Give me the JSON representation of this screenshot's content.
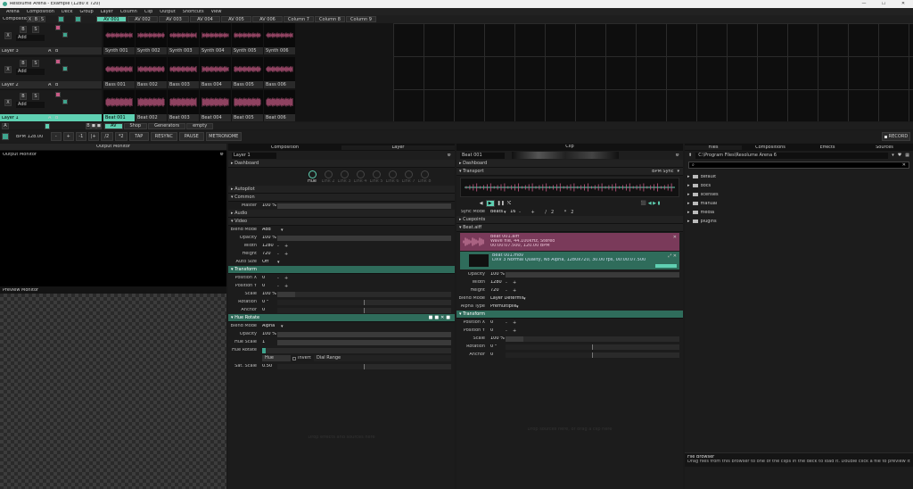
{
  "window": {
    "title": "Resolume Arena - Example (1280 x 720)"
  },
  "menu": [
    "Arena",
    "Composition",
    "Deck",
    "Group",
    "Layer",
    "Column",
    "Clip",
    "Output",
    "Shortcuts",
    "View"
  ],
  "composition": {
    "label": "Composition",
    "x": "X",
    "b": "B",
    "s": "S"
  },
  "columns": [
    "AV 001",
    "AV 002",
    "AV 003",
    "AV 004",
    "AV 005",
    "AV 006",
    "Column 7",
    "Column 8",
    "Column 9"
  ],
  "layers": [
    {
      "name": "Layer 3",
      "blend": "Add",
      "clips": [
        "Synth 001",
        "Synth 002",
        "Synth 003",
        "Synth 004",
        "Synth 005",
        "Synth 006"
      ]
    },
    {
      "name": "Layer 2",
      "blend": "Add",
      "clips": [
        "Bass 001",
        "Bass 002",
        "Bass 003",
        "Bass 004",
        "Bass 005",
        "Bass 006"
      ]
    },
    {
      "name": "Layer 1",
      "blend": "Add",
      "clips": [
        "Beat 001",
        "Beat 002",
        "Beat 003",
        "Beat 004",
        "Beat 005",
        "Beat 006"
      ]
    }
  ],
  "layer_controls": {
    "x": "X",
    "b": "B",
    "s": "S",
    "a": "A",
    "bb": "B"
  },
  "decks": [
    "AV",
    "Shop",
    "Generators",
    "empty"
  ],
  "transport": {
    "bpm_label": "BPM",
    "bpm": "128.00",
    "minus": "-",
    "plus": "+",
    "m1": "-1",
    "p1": "|+",
    "half": "/2",
    "dbl": "*2",
    "tap": "TAP",
    "resync": "RESYNC",
    "pause": "PAUSE",
    "metronome": "METRONOME",
    "record": "RECORD"
  },
  "output_monitor": {
    "title": "Output Monitor",
    "label": "Output Monitor"
  },
  "preview_monitor": {
    "label": "Preview Monitor"
  },
  "tabs_mid": [
    "Composition",
    "Layer"
  ],
  "layer_panel": {
    "name": "Layer 1",
    "dashboard": "Dashboard",
    "dash_knobs": [
      "Hue",
      "Link 2",
      "Link 3",
      "Link 4",
      "Link 5",
      "Link 6",
      "Link 7",
      "Link 8"
    ],
    "autopilot": "Autopilot",
    "common": "Common",
    "master_label": "Master",
    "master_val": "100 %",
    "audio": "Audio",
    "video": "Video",
    "blend_label": "Blend Mode",
    "blend_val": "Add",
    "opacity_label": "Opacity",
    "opacity_val": "100 %",
    "width_label": "Width",
    "width_val": "1280",
    "height_label": "Height",
    "height_val": "720",
    "autosize_label": "Auto Size",
    "autosize_val": "Off",
    "transform": "Transform",
    "posx_label": "Position X",
    "posx_val": "0",
    "posy_label": "Position Y",
    "posy_val": "0",
    "scale_label": "Scale",
    "scale_val": "100 %",
    "rotation_label": "Rotation",
    "rotation_val": "0 °",
    "anchor_label": "Anchor",
    "anchor_val": "0",
    "hue_rotate": "Hue Rotate",
    "hr_blend_label": "Blend Mode",
    "hr_blend_val": "Alpha",
    "hr_opacity_label": "Opacity",
    "hr_opacity_val": "100 %",
    "hue_scale_label": "Hue Scale",
    "hue_scale_val": "1",
    "hue_rot_label": "Hue Rotate",
    "hue_chip": "Hue",
    "invert": "Invert",
    "dial": "Dial Range",
    "sat_label": "Sat. Scale",
    "sat_val": "0.50",
    "drop_hint": "Drop effects and sources here"
  },
  "clip_panel": {
    "tab": "Clip",
    "name": "Beat 001",
    "dashboard": "Dashboard",
    "transport": "Transport",
    "bpm_sync": "BPM Sync",
    "sync_label": "Sync Mode",
    "sync_val": "Beats",
    "beats": "16",
    "cuepoints": "Cuepoints",
    "audio_file": "Beat.aiff",
    "audio_info": "Beat 001.aiff",
    "audio_info2": "Wave file, 44.100kHz, Stereo",
    "audio_info3": "00:00:07.500, 120.00 BPM",
    "video_info": "Beat 001.mov",
    "video_info2": "DXV 3 Normal Quality, No Alpha, 1280x720, 30.00 fps, 00:00:07.500",
    "opacity_label": "Opacity",
    "opacity_val": "100 %",
    "width_label": "Width",
    "width_val": "1280",
    "height_label": "Height",
    "height_val": "720",
    "blend_label": "Blend Mode",
    "blend_val": "Layer Determined",
    "alpha_label": "Alpha Type",
    "alpha_val": "Premultiplied",
    "transform": "Transform",
    "posx_label": "Position X",
    "posx_val": "0",
    "posy_label": "Position Y",
    "posy_val": "0",
    "scale_label": "Scale",
    "scale_val": "100 %",
    "rotation_label": "Rotation",
    "rotation_val": "0 °",
    "anchor_label": "Anchor",
    "anchor_val": "0",
    "drop_hint": "Drop sources here, or drag a clip here"
  },
  "browser": {
    "tabs": [
      "Files",
      "Compositions",
      "Effects",
      "Sources"
    ],
    "path": "C:\\Program Files\\Resolume Arena 6",
    "folders": [
      "default",
      "docs",
      "licenses",
      "manual",
      "media",
      "plugins"
    ],
    "help_title": "File Browser",
    "help_text": "Drag files from this browser to one of the clips in the deck to load it. Double click a file to preview it in the preview monitor."
  }
}
